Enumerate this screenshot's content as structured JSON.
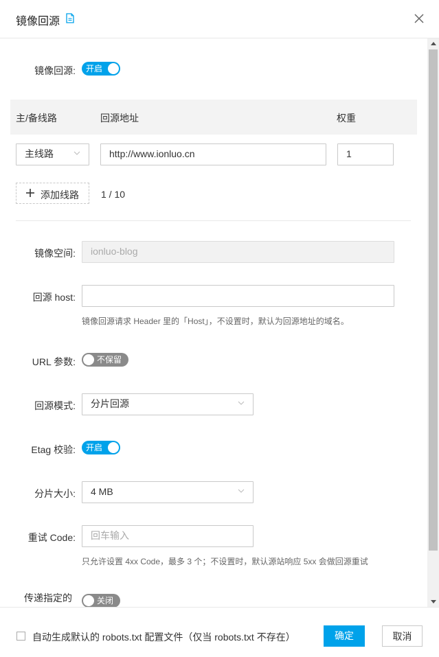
{
  "dialog": {
    "title": "镜像回源",
    "icons": {
      "doc": "document-icon",
      "close": "close-icon"
    }
  },
  "mirror": {
    "label": "镜像回源:",
    "toggle": "开启"
  },
  "lines_table": {
    "headers": [
      "主/备线路",
      "回源地址",
      "权重"
    ],
    "rows": [
      {
        "type": "主线路",
        "address": "http://www.ionluo.cn",
        "weight": "1"
      }
    ],
    "add_button": "添加线路",
    "count": "1 / 10"
  },
  "form": {
    "space": {
      "label": "镜像空间:",
      "value": "ionluo-blog"
    },
    "host": {
      "label": "回源 host:",
      "value": "",
      "hint": "镜像回源请求 Header 里的「Host」，不设置时，默认为回源地址的域名。"
    },
    "url_params": {
      "label": "URL 参数:",
      "toggle": "不保留"
    },
    "mode": {
      "label": "回源模式:",
      "value": "分片回源"
    },
    "etag": {
      "label": "Etag 校验:",
      "toggle": "开启"
    },
    "chunk": {
      "label": "分片大小:",
      "value": "4 MB"
    },
    "retry": {
      "label": "重试 Code:",
      "placeholder": "回车输入",
      "hint": "只允许设置 4xx Code，最多 3 个；不设置时，默认源站响应 5xx 会做回源重试"
    },
    "pass": {
      "label": "传递指定的",
      "toggle": "关闭"
    }
  },
  "footer": {
    "checkbox_label": "自动生成默认的 robots.txt 配置文件（仅当 robots.txt 不存在）",
    "confirm": "确定",
    "cancel": "取消"
  },
  "colors": {
    "accent": "#00a2ea",
    "toggle_off": "#8a8a8a"
  }
}
